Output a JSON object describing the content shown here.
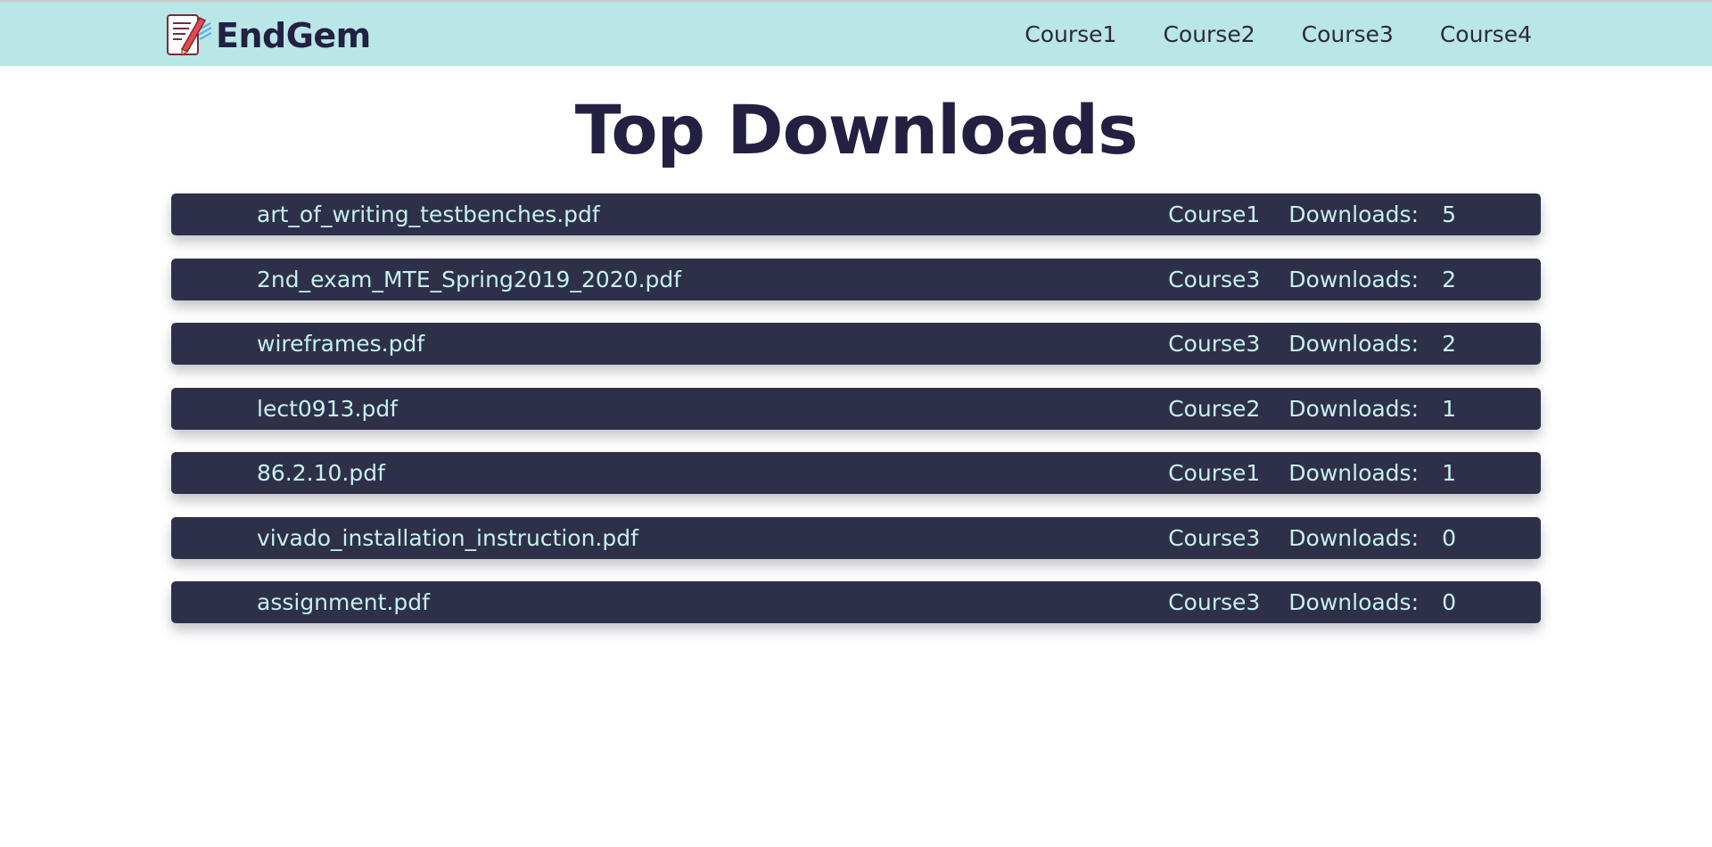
{
  "header": {
    "brand_name": "EndGem",
    "logo_icon": "notepad-pencil-icon",
    "nav": [
      {
        "label": "Course1"
      },
      {
        "label": "Course2"
      },
      {
        "label": "Course3"
      },
      {
        "label": "Course4"
      }
    ]
  },
  "main": {
    "title": "Top Downloads",
    "downloads_label": "Downloads:",
    "files": [
      {
        "name": "art_of_writing_testbenches.pdf",
        "course": "Course1",
        "downloads": "5"
      },
      {
        "name": "2nd_exam_MTE_Spring2019_2020.pdf",
        "course": "Course3",
        "downloads": "2"
      },
      {
        "name": "wireframes.pdf",
        "course": "Course3",
        "downloads": "2"
      },
      {
        "name": "lect0913.pdf",
        "course": "Course2",
        "downloads": "1"
      },
      {
        "name": "86.2.10.pdf",
        "course": "Course1",
        "downloads": "1"
      },
      {
        "name": "vivado_installation_instruction.pdf",
        "course": "Course3",
        "downloads": "0"
      },
      {
        "name": "assignment.pdf",
        "course": "Course3",
        "downloads": "0"
      }
    ]
  },
  "colors": {
    "header_bg": "#b9e6e6",
    "row_bg": "#2e3049",
    "row_text": "#c5f0f0",
    "title": "#232042"
  }
}
